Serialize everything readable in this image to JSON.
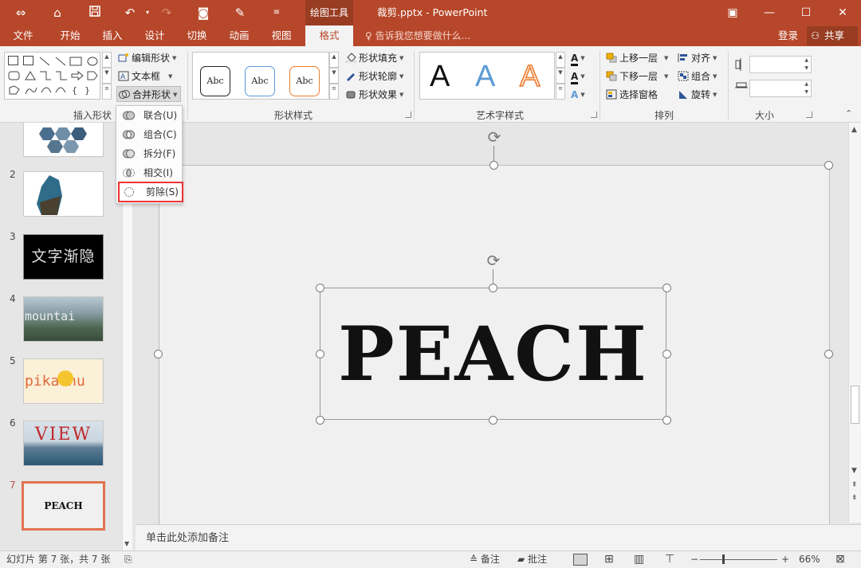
{
  "title_bar": {
    "context_tool": "绘图工具",
    "document_title": "裁剪.pptx - PowerPoint"
  },
  "tabs": [
    {
      "label": "文件",
      "active": false
    },
    {
      "label": "开始",
      "active": false
    },
    {
      "label": "插入",
      "active": false
    },
    {
      "label": "设计",
      "active": false
    },
    {
      "label": "切换",
      "active": false
    },
    {
      "label": "动画",
      "active": false
    },
    {
      "label": "视图",
      "active": false
    },
    {
      "label": "格式",
      "active": true
    }
  ],
  "tell_me": "告诉我您想要做什么...",
  "account": {
    "login": "登录",
    "share": "共享"
  },
  "ribbon": {
    "insert_shapes": {
      "label": "插入形状",
      "edit_shape": "编辑形状",
      "text_box": "文本框",
      "merge_shapes": "合并形状"
    },
    "shape_styles": {
      "label": "形状样式",
      "samples": [
        "Abc",
        "Abc",
        "Abc"
      ],
      "sample_colors": [
        "#222222",
        "#5b9bd5",
        "#ed7d31"
      ],
      "fill": "形状填充",
      "outline": "形状轮廓",
      "effects": "形状效果"
    },
    "wordart_styles": {
      "label": "艺术字样式",
      "samples": [
        "A",
        "A",
        "A"
      ],
      "sample_colors": [
        "#111111",
        "#5b9bd5",
        "#ed7d31"
      ]
    },
    "arrange": {
      "label": "排列",
      "bring_forward": "上移一层",
      "send_backward": "下移一层",
      "selection_pane": "选择窗格",
      "align": "对齐",
      "group": "组合",
      "rotate": "旋转"
    },
    "size": {
      "label": "大小",
      "height": "",
      "width": ""
    }
  },
  "merge_menu": {
    "items": [
      {
        "label": "联合(U)",
        "highlighted": false
      },
      {
        "label": "组合(C)",
        "highlighted": false
      },
      {
        "label": "拆分(F)",
        "highlighted": false
      },
      {
        "label": "相交(I)",
        "highlighted": false
      },
      {
        "label": "剪除(S)",
        "highlighted": true
      }
    ],
    "highlight_color": "#ee3333"
  },
  "slides": [
    {
      "number": "2",
      "content": ""
    },
    {
      "number": "3",
      "content": "文字渐隐"
    },
    {
      "number": "4",
      "content": "mountai"
    },
    {
      "number": "5",
      "content": "pikachu"
    },
    {
      "number": "6",
      "content": "VIEW"
    },
    {
      "number": "7",
      "content": "PEACH",
      "selected": true
    }
  ],
  "slide_canvas": {
    "text": "PEACH"
  },
  "notes": {
    "placeholder": "单击此处添加备注"
  },
  "status_bar": {
    "slide_info": "幻灯片 第 7 张，共 7 张",
    "notes_btn": "备注",
    "comments_btn": "批注",
    "zoom": "66%"
  },
  "colors": {
    "accent": "#b7472a",
    "accent_dark": "#983c22",
    "selection": "#e0734f"
  }
}
